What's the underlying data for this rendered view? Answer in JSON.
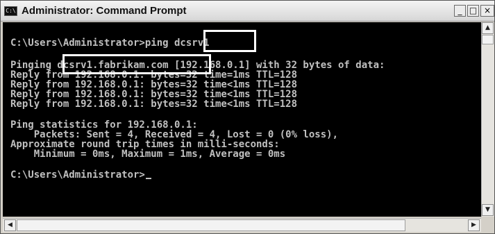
{
  "window": {
    "title": "Administrator: Command Prompt",
    "icon_label": "C:\\",
    "minimize_glyph": "_",
    "maximize_glyph": "□",
    "close_glyph": "×"
  },
  "console": {
    "lines": [
      "C:\\Users\\Administrator>ping dcsrv1",
      "",
      "Pinging dcsrv1.fabrikam.com [192.168.0.1] with 32 bytes of data:",
      "Reply from 192.168.0.1: bytes=32 time=1ms TTL=128",
      "Reply from 192.168.0.1: bytes=32 time<1ms TTL=128",
      "Reply from 192.168.0.1: bytes=32 time<1ms TTL=128",
      "Reply from 192.168.0.1: bytes=32 time<1ms TTL=128",
      "",
      "Ping statistics for 192.168.0.1:",
      "    Packets: Sent = 4, Received = 4, Lost = 0 (0% loss),",
      "Approximate round trip times in milli-seconds:",
      "    Minimum = 0ms, Maximum = 1ms, Average = 0ms",
      "",
      "C:\\Users\\Administrator>"
    ]
  },
  "scrollbars": {
    "up_arrow": "▲",
    "down_arrow": "▼",
    "left_arrow": "◀",
    "right_arrow": "▶"
  },
  "colors": {
    "console_background": "#000000",
    "console_text": "#c0c0c0",
    "highlight_box": "#ffffff"
  }
}
